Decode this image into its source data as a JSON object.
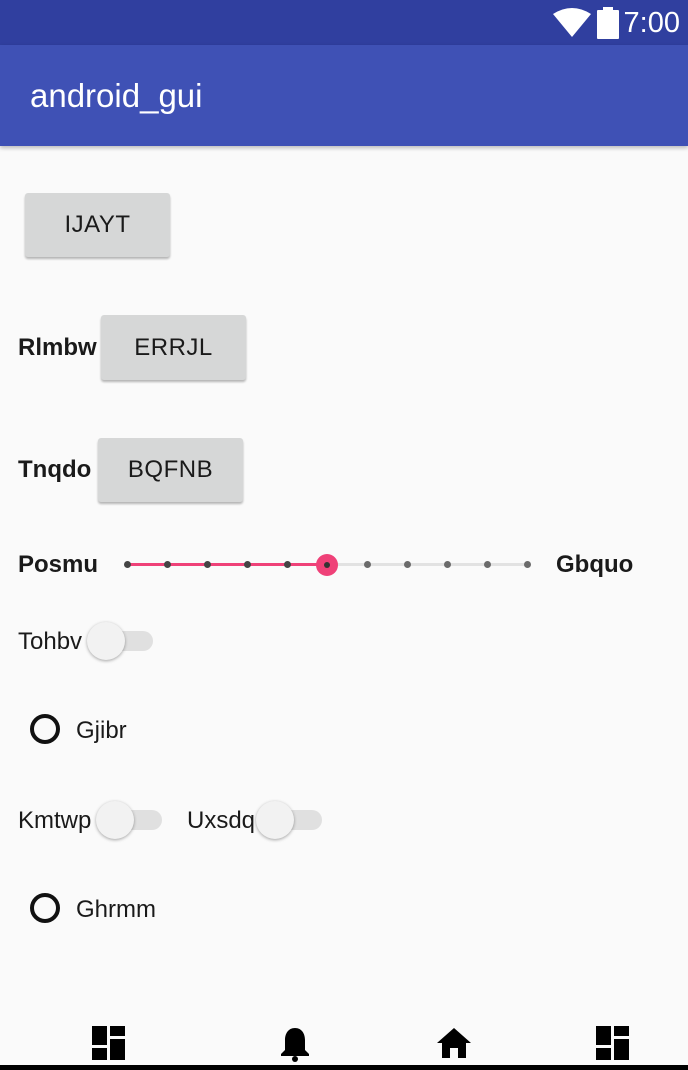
{
  "status_bar": {
    "time": "7:00",
    "icons": [
      "wifi-icon",
      "battery-icon"
    ]
  },
  "app_bar": {
    "title": "android_gui",
    "color": "#3f51b5"
  },
  "controls": {
    "button_ijayt": "IJAYT",
    "label_rlmbw": "Rlmbw",
    "button_errjl": "ERRJL",
    "label_tnqdo": "Tnqdo",
    "button_bqfnb": "BQFNB",
    "seekbar": {
      "left_label": "Posmu",
      "right_label": "Gbquo",
      "max": 10,
      "value": 5,
      "accent": "#ef4178"
    },
    "switch_tohbv": {
      "label": "Tohbv",
      "checked": false
    },
    "radio_gjibr": {
      "label": "Gjibr",
      "checked": false
    },
    "switch_kmtwp": {
      "label": "Kmtwp",
      "checked": false
    },
    "switch_uxsdq": {
      "label": "Uxsdq",
      "checked": false
    },
    "radio_ghrmm": {
      "label": "Ghrmm",
      "checked": false
    }
  },
  "bottom_nav": {
    "icons": [
      "dashboard-icon",
      "bell-icon",
      "home-icon",
      "dashboard-icon"
    ]
  }
}
